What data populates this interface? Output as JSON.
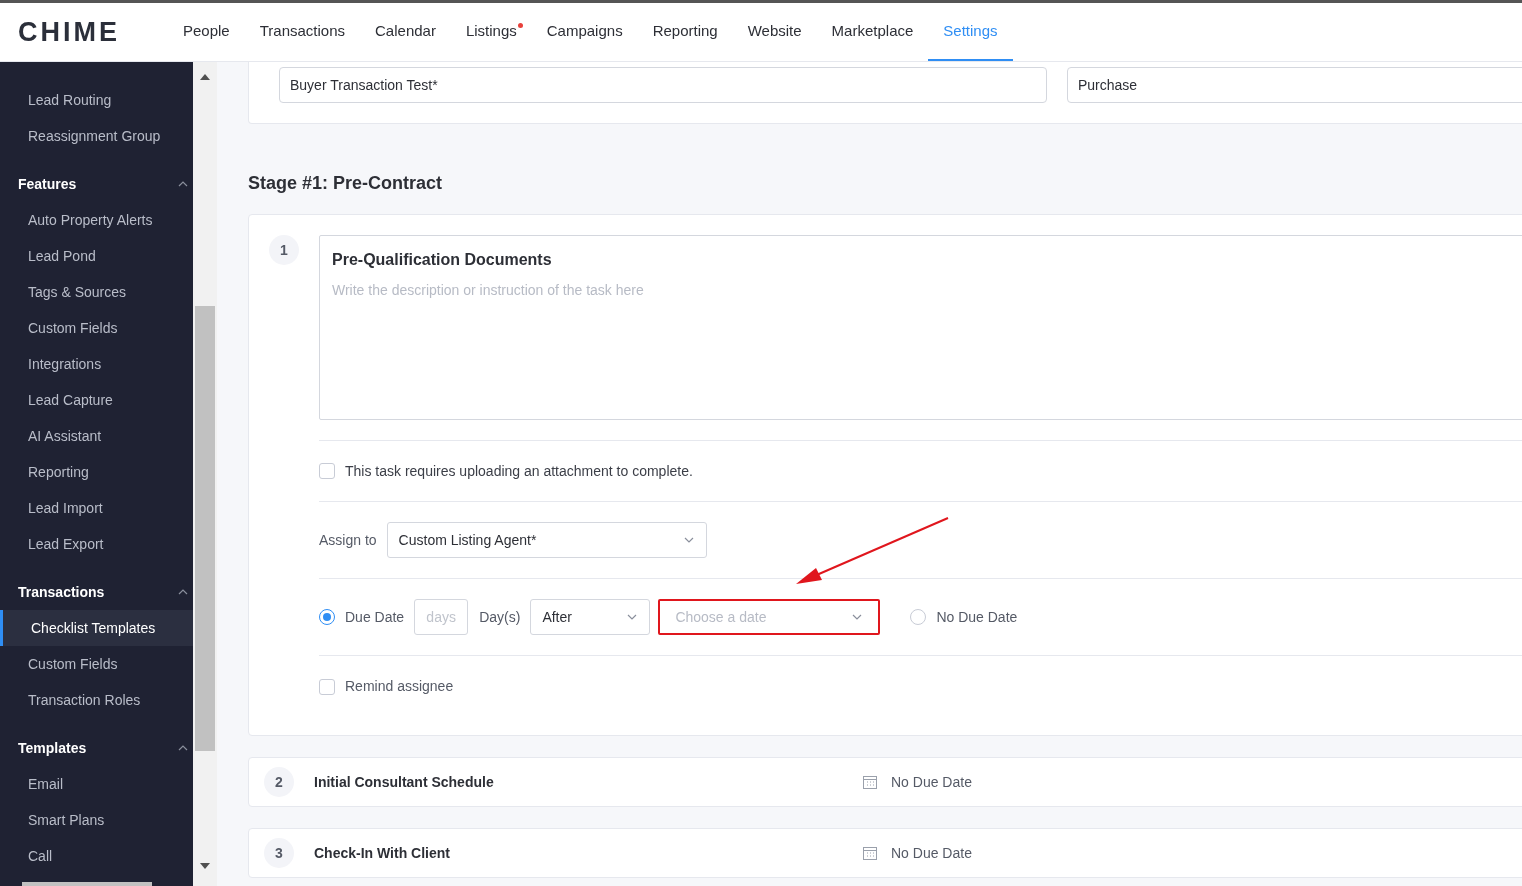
{
  "logo": "CHIME",
  "nav": [
    {
      "label": "People",
      "selected": false,
      "dot": false
    },
    {
      "label": "Transactions",
      "selected": false,
      "dot": false
    },
    {
      "label": "Calendar",
      "selected": false,
      "dot": false
    },
    {
      "label": "Listings",
      "selected": false,
      "dot": true
    },
    {
      "label": "Campaigns",
      "selected": false,
      "dot": false
    },
    {
      "label": "Reporting",
      "selected": false,
      "dot": false
    },
    {
      "label": "Website",
      "selected": false,
      "dot": false
    },
    {
      "label": "Marketplace",
      "selected": false,
      "dot": false
    },
    {
      "label": "Settings",
      "selected": true,
      "dot": false
    }
  ],
  "sidebar": [
    {
      "items": [
        {
          "label": "Lead Routing",
          "selected": false
        },
        {
          "label": "Reassignment Group",
          "selected": false
        }
      ]
    },
    {
      "title": "Features",
      "items": [
        {
          "label": "Auto Property Alerts",
          "selected": false
        },
        {
          "label": "Lead Pond",
          "selected": false
        },
        {
          "label": "Tags & Sources",
          "selected": false
        },
        {
          "label": "Custom Fields",
          "selected": false
        },
        {
          "label": "Integrations",
          "selected": false
        },
        {
          "label": "Lead Capture",
          "selected": false
        },
        {
          "label": "AI Assistant",
          "selected": false
        },
        {
          "label": "Reporting",
          "selected": false
        },
        {
          "label": "Lead Import",
          "selected": false
        },
        {
          "label": "Lead Export",
          "selected": false
        }
      ]
    },
    {
      "title": "Transactions",
      "items": [
        {
          "label": "Checklist Templates",
          "selected": true
        },
        {
          "label": "Custom Fields",
          "selected": false
        },
        {
          "label": "Transaction Roles",
          "selected": false
        }
      ]
    },
    {
      "title": "Templates",
      "items": [
        {
          "label": "Email",
          "selected": false
        },
        {
          "label": "Smart Plans",
          "selected": false
        },
        {
          "label": "Call",
          "selected": false
        }
      ]
    }
  ],
  "template_fields": [
    {
      "value": "Buyer Transaction Test*"
    },
    {
      "value": "Purchase"
    }
  ],
  "stage_title": "Stage #1: Pre-Contract",
  "open_task": {
    "number": "1",
    "title": "Pre-Qualification Documents",
    "description_placeholder": "Write the description or instruction of the task here",
    "attachment": {
      "label": "This task requires uploading an attachment to complete.",
      "checked": false
    },
    "assign_label": "Assign to",
    "assign_value": "Custom Listing Agent*",
    "due_date": {
      "label": "Due Date",
      "selected": true,
      "days_placeholder": "days",
      "unit": "Day(s)",
      "relation": "After",
      "date_placeholder": "Choose a date",
      "highlighted": true
    },
    "no_due_date": {
      "label": "No Due Date",
      "selected": false
    },
    "remind": {
      "label": "Remind assignee",
      "checked": false
    }
  },
  "tasks": [
    {
      "number": "2",
      "title": "Initial Consultant Schedule",
      "due": "No Due Date"
    },
    {
      "number": "3",
      "title": "Check-In With Client",
      "due": "No Due Date"
    }
  ]
}
